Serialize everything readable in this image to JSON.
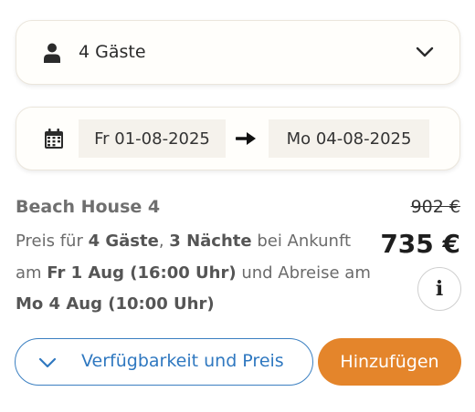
{
  "guests": {
    "label": "4 Gäste",
    "icon": "person-icon",
    "dropdown_icon": "chevron-down-icon"
  },
  "dates": {
    "icon": "calendar-icon",
    "start": "Fr 01-08-2025",
    "arrow_icon": "arrow-right-icon",
    "end": "Mo 04-08-2025"
  },
  "offer": {
    "title": "Beach House 4",
    "desc": {
      "t1": "Preis für ",
      "guests": "4 Gäste",
      "t2": ", ",
      "nights": "3 Nächte",
      "t3": " bei Ankunft am ",
      "arrival": "Fr 1 Aug (16:00 Uhr)",
      "t4": " und Abreise am ",
      "departure": "Mo 4 Aug (10:00 Uhr)"
    },
    "old_price": "902 €",
    "price": "735 €",
    "info_label": "i"
  },
  "actions": {
    "availability_label": "Verfügbarkeit und Preis",
    "add_label": "Hinzufügen"
  },
  "colors": {
    "accent_orange": "#e4852b",
    "accent_blue": "#2f78c0"
  }
}
